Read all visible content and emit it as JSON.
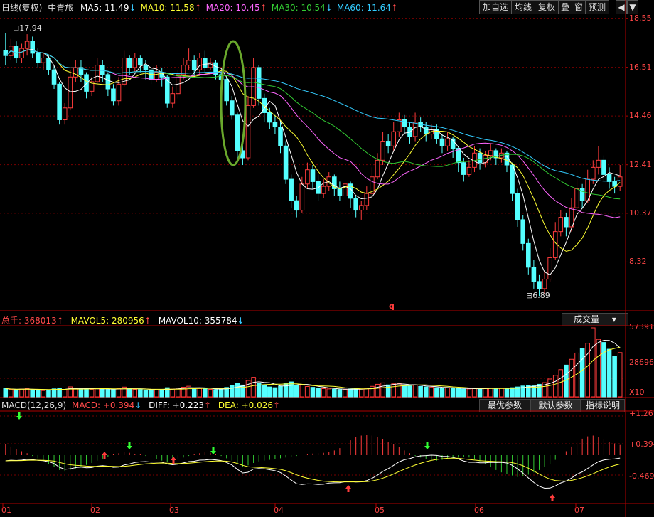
{
  "header": {
    "title": "日线(复权)",
    "stock": "中青旅",
    "ma": [
      {
        "label": "MA5: 11.49",
        "dir": "down",
        "color": "#ffffff"
      },
      {
        "label": "MA10: 11.58",
        "dir": "up",
        "color": "#ffff33"
      },
      {
        "label": "MA20: 10.45",
        "dir": "up",
        "color": "#ff66ff"
      },
      {
        "label": "MA30: 10.54",
        "dir": "down",
        "color": "#33cc33"
      },
      {
        "label": "MA60: 11.64",
        "dir": "up",
        "color": "#33ccff"
      }
    ],
    "buttons": [
      "加自选",
      "均线",
      "复权",
      "叠",
      "窗",
      "预测"
    ]
  },
  "price_axis": [
    "18.55",
    "16.51",
    "14.46",
    "12.41",
    "10.37",
    "8.32"
  ],
  "markers": {
    "high": "17.94",
    "low": "6.89",
    "cursor": "q"
  },
  "volume": {
    "label": "总手: 368013",
    "mavol5": "MAVOL5: 280956",
    "mavol10": "MAVOL10: 355784",
    "selector": "成交量",
    "axis": [
      "57391",
      "28696",
      "X10"
    ]
  },
  "macd": {
    "label": "MACD(12,26,9)",
    "macd": "MACD: +0.394",
    "diff": "DIFF: +0.223",
    "dea": "DEA: +0.026",
    "buttons": [
      "最优参数",
      "默认参数",
      "指标说明"
    ],
    "axis": [
      "+1.26",
      "+0.394",
      "-0.469"
    ]
  },
  "x_axis": [
    "01",
    "02",
    "03",
    "04",
    "05",
    "06",
    "07"
  ],
  "colors": {
    "up": "#ff3c3c",
    "down": "#54ffff",
    "grid": "#7a0000",
    "axis": "#b00000"
  },
  "chart_data": {
    "type": "candlestick",
    "price_range": [
      6.3,
      18.8
    ],
    "months": [
      "01",
      "02",
      "03",
      "04",
      "05",
      "06",
      "07"
    ],
    "highest": 17.94,
    "lowest": 6.89,
    "last_ma": {
      "MA5": 11.49,
      "MA10": 11.58,
      "MA20": 10.45,
      "MA30": 10.54,
      "MA60": 11.64
    },
    "candles": [
      [
        17.2,
        17.0,
        17.94,
        16.6
      ],
      [
        17.0,
        17.4,
        17.7,
        16.8
      ],
      [
        17.4,
        16.9,
        17.6,
        16.7
      ],
      [
        16.9,
        17.3,
        17.5,
        16.7
      ],
      [
        17.3,
        17.6,
        17.9,
        17.0
      ],
      [
        17.6,
        17.1,
        17.8,
        16.9
      ],
      [
        17.1,
        16.7,
        17.3,
        16.5
      ],
      [
        16.7,
        16.9,
        17.1,
        16.4
      ],
      [
        16.9,
        16.4,
        17.0,
        16.2
      ],
      [
        16.4,
        15.8,
        16.6,
        15.6
      ],
      [
        15.8,
        14.3,
        15.9,
        14.1
      ],
      [
        14.3,
        14.8,
        15.0,
        14.1
      ],
      [
        14.8,
        16.1,
        16.4,
        14.7
      ],
      [
        16.1,
        16.5,
        16.8,
        15.9
      ],
      [
        16.5,
        16.2,
        16.8,
        15.9
      ],
      [
        16.2,
        15.5,
        16.3,
        15.2
      ],
      [
        15.5,
        15.9,
        16.1,
        15.3
      ],
      [
        15.9,
        16.6,
        16.9,
        15.8
      ],
      [
        16.6,
        16.2,
        16.8,
        15.9
      ],
      [
        16.2,
        15.6,
        16.3,
        15.3
      ],
      [
        15.6,
        15.1,
        15.8,
        14.9
      ],
      [
        15.1,
        15.8,
        16.1,
        14.9
      ],
      [
        15.8,
        16.9,
        17.2,
        15.7
      ],
      [
        16.9,
        16.5,
        17.0,
        16.2
      ],
      [
        16.5,
        16.9,
        17.1,
        16.3
      ],
      [
        16.9,
        16.6,
        17.0,
        16.3
      ],
      [
        16.6,
        16.4,
        16.8,
        16.0
      ],
      [
        16.4,
        16.0,
        16.5,
        15.8
      ],
      [
        16.0,
        16.3,
        16.6,
        15.9
      ],
      [
        16.3,
        16.1,
        16.5,
        15.7
      ],
      [
        16.1,
        15.0,
        16.2,
        14.8
      ],
      [
        15.0,
        15.4,
        15.7,
        14.8
      ],
      [
        15.4,
        16.2,
        16.4,
        15.2
      ],
      [
        16.2,
        16.6,
        16.9,
        16.0
      ],
      [
        16.6,
        16.8,
        17.3,
        16.4
      ],
      [
        16.8,
        16.4,
        17.0,
        16.1
      ],
      [
        16.4,
        16.9,
        17.1,
        16.2
      ],
      [
        16.9,
        16.5,
        17.2,
        16.3
      ],
      [
        16.5,
        16.7,
        16.9,
        16.4
      ],
      [
        16.7,
        16.2,
        16.8,
        16.0
      ],
      [
        16.2,
        16.0,
        16.4,
        15.8
      ],
      [
        16.0,
        15.1,
        16.1,
        14.9
      ],
      [
        15.1,
        14.5,
        15.3,
        14.3
      ],
      [
        14.5,
        13.0,
        14.6,
        12.5
      ],
      [
        13.0,
        12.7,
        13.3,
        12.4
      ],
      [
        12.7,
        14.9,
        15.3,
        12.6
      ],
      [
        14.9,
        16.5,
        16.9,
        14.8
      ],
      [
        16.5,
        15.2,
        16.6,
        14.9
      ],
      [
        15.2,
        14.6,
        15.4,
        14.2
      ],
      [
        14.6,
        14.2,
        14.8,
        13.9
      ],
      [
        14.2,
        14.0,
        14.5,
        13.7
      ],
      [
        14.0,
        13.2,
        14.2,
        12.9
      ],
      [
        13.2,
        11.8,
        13.4,
        11.6
      ],
      [
        11.8,
        10.9,
        12.0,
        10.6
      ],
      [
        10.9,
        10.5,
        11.1,
        10.2
      ],
      [
        10.5,
        11.6,
        11.9,
        10.4
      ],
      [
        11.6,
        12.2,
        12.5,
        11.4
      ],
      [
        12.2,
        11.7,
        12.4,
        11.4
      ],
      [
        11.7,
        11.2,
        12.0,
        10.9
      ],
      [
        11.2,
        11.5,
        11.8,
        11.0
      ],
      [
        11.5,
        11.9,
        12.1,
        11.3
      ],
      [
        11.9,
        11.4,
        12.0,
        11.1
      ],
      [
        11.4,
        11.1,
        11.7,
        10.9
      ],
      [
        11.1,
        11.6,
        11.8,
        10.8
      ],
      [
        11.6,
        11.0,
        11.7,
        10.6
      ],
      [
        11.0,
        10.5,
        11.1,
        10.2
      ],
      [
        10.5,
        10.7,
        10.9,
        10.1
      ],
      [
        10.7,
        11.2,
        11.5,
        10.5
      ],
      [
        11.2,
        11.9,
        12.3,
        11.0
      ],
      [
        11.9,
        12.6,
        12.9,
        11.8
      ],
      [
        12.6,
        13.4,
        13.8,
        12.4
      ],
      [
        13.4,
        13.2,
        13.7,
        12.9
      ],
      [
        13.2,
        13.8,
        14.2,
        13.0
      ],
      [
        13.8,
        14.3,
        14.6,
        13.6
      ],
      [
        14.3,
        14.0,
        14.5,
        13.7
      ],
      [
        14.0,
        13.6,
        14.2,
        13.3
      ],
      [
        13.6,
        14.2,
        14.6,
        13.4
      ],
      [
        14.2,
        14.0,
        14.4,
        13.8
      ],
      [
        14.0,
        13.7,
        14.2,
        13.4
      ],
      [
        13.7,
        13.9,
        14.1,
        13.5
      ],
      [
        13.9,
        13.5,
        14.1,
        13.3
      ],
      [
        13.5,
        13.2,
        13.7,
        12.9
      ],
      [
        13.2,
        13.5,
        13.8,
        13.0
      ],
      [
        13.5,
        13.1,
        13.6,
        12.7
      ],
      [
        13.1,
        12.5,
        13.2,
        12.1
      ],
      [
        12.5,
        12.0,
        12.7,
        11.7
      ],
      [
        12.0,
        12.3,
        12.6,
        11.9
      ],
      [
        12.3,
        12.9,
        13.2,
        12.1
      ],
      [
        12.9,
        12.5,
        13.1,
        12.2
      ],
      [
        12.5,
        12.8,
        13.0,
        12.3
      ],
      [
        12.8,
        13.0,
        13.3,
        12.6
      ],
      [
        13.0,
        12.7,
        13.1,
        12.4
      ],
      [
        12.7,
        12.9,
        13.1,
        12.5
      ],
      [
        12.9,
        12.4,
        13.0,
        12.1
      ],
      [
        12.4,
        11.2,
        12.5,
        10.9
      ],
      [
        11.2,
        10.1,
        11.4,
        9.8
      ],
      [
        10.1,
        9.1,
        10.3,
        8.8
      ],
      [
        9.1,
        8.1,
        9.3,
        7.8
      ],
      [
        8.1,
        7.5,
        8.4,
        7.2
      ],
      [
        7.5,
        7.2,
        7.8,
        6.89
      ],
      [
        7.2,
        7.6,
        7.9,
        7.0
      ],
      [
        7.6,
        8.5,
        8.9,
        7.5
      ],
      [
        8.5,
        9.6,
        10.0,
        8.4
      ],
      [
        9.6,
        10.2,
        10.5,
        9.4
      ],
      [
        10.2,
        9.8,
        10.4,
        9.4
      ],
      [
        9.8,
        10.6,
        11.0,
        9.6
      ],
      [
        10.6,
        11.4,
        11.8,
        10.4
      ],
      [
        11.4,
        10.9,
        11.6,
        10.6
      ],
      [
        10.9,
        11.8,
        12.2,
        10.8
      ],
      [
        11.8,
        12.3,
        12.6,
        11.6
      ],
      [
        12.3,
        12.6,
        13.2,
        12.0
      ],
      [
        12.6,
        12.0,
        12.8,
        11.7
      ],
      [
        12.0,
        11.7,
        12.3,
        11.4
      ],
      [
        11.7,
        11.5,
        11.9,
        11.2
      ],
      [
        11.5,
        11.9,
        12.4,
        11.3
      ]
    ],
    "volume": [
      6800,
      6200,
      5900,
      6400,
      7000,
      6000,
      5500,
      5200,
      5800,
      6600,
      7400,
      6100,
      8300,
      7000,
      6400,
      6900,
      6000,
      7200,
      6500,
      6100,
      5900,
      6800,
      8100,
      6700,
      6200,
      6000,
      5700,
      5500,
      5800,
      6100,
      7600,
      6400,
      7300,
      8000,
      8800,
      7100,
      6900,
      6600,
      6200,
      6000,
      6400,
      7800,
      9200,
      11500,
      9800,
      13600,
      16200,
      11200,
      9400,
      8200,
      7600,
      8800,
      10900,
      12400,
      9600,
      10100,
      8600,
      7900,
      7200,
      6800,
      6600,
      6300,
      6000,
      6200,
      6500,
      6900,
      6400,
      7200,
      8700,
      10400,
      11600,
      9900,
      10800,
      11200,
      9600,
      9000,
      9800,
      8600,
      8200,
      7900,
      7600,
      7300,
      7700,
      7100,
      6800,
      6400,
      6600,
      7000,
      6800,
      7200,
      7400,
      7100,
      7000,
      6800,
      7600,
      8200,
      9000,
      9600,
      9100,
      10400,
      11800,
      14800,
      17900,
      22600,
      26400,
      31200,
      36400,
      40100,
      44600,
      57391,
      47800,
      45200,
      39600,
      33800,
      36800
    ],
    "macd_bars": [
      0.28,
      0.22,
      0.16,
      0.1,
      0.05,
      -0.02,
      -0.08,
      -0.14,
      -0.22,
      -0.3,
      -0.38,
      -0.42,
      -0.38,
      -0.34,
      -0.3,
      -0.25,
      -0.2,
      -0.14,
      -0.09,
      -0.05,
      0.03,
      0.05,
      0.08,
      0.06,
      0.03,
      0.02,
      -0.02,
      -0.06,
      -0.1,
      -0.14,
      -0.18,
      -0.14,
      -0.1,
      -0.06,
      -0.02,
      0.02,
      0.05,
      0.07,
      0.06,
      0.03,
      -0.02,
      -0.08,
      -0.14,
      -0.22,
      -0.3,
      -0.26,
      -0.2,
      -0.16,
      -0.14,
      -0.12,
      -0.1,
      -0.08,
      -0.06,
      -0.04,
      -0.02,
      0.0,
      0.02,
      0.04,
      0.05,
      0.06,
      0.08,
      0.12,
      0.18,
      0.28,
      0.38,
      0.46,
      0.5,
      0.52,
      0.5,
      0.46,
      0.4,
      0.34,
      0.28,
      0.2,
      0.12,
      0.05,
      -0.02,
      -0.06,
      -0.1,
      -0.12,
      -0.14,
      -0.12,
      -0.1,
      -0.08,
      -0.06,
      -0.04,
      -0.06,
      -0.1,
      -0.16,
      -0.22,
      -0.3,
      -0.38,
      -0.44,
      -0.48,
      -0.52,
      -0.56,
      -0.54,
      -0.5,
      -0.44,
      -0.38,
      -0.3,
      -0.22,
      -0.12,
      0.0,
      0.1,
      0.22,
      0.32,
      0.42,
      0.48,
      0.5,
      0.46,
      0.4,
      0.34,
      0.3,
      0.26
    ]
  }
}
